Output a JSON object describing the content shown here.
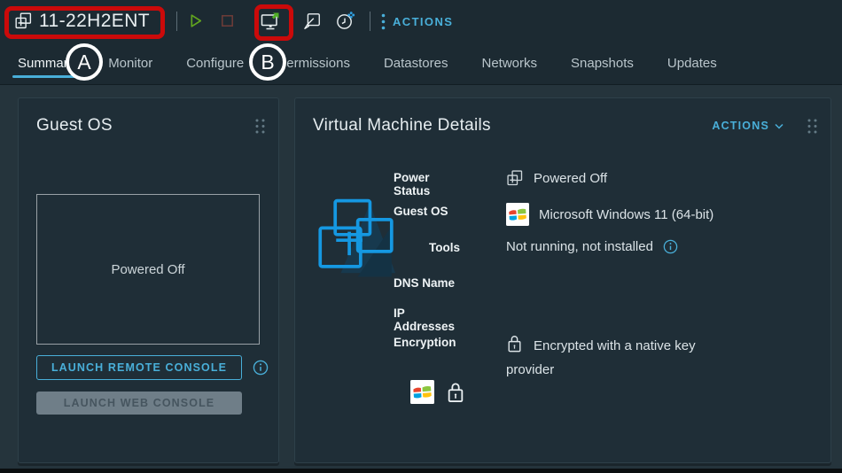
{
  "header": {
    "vm_name": "11-22H2ENT",
    "actions_label": "ACTIONS"
  },
  "tabs": {
    "active": "Summary",
    "items": [
      "Summary",
      "Monitor",
      "Configure",
      "Permissions",
      "Datastores",
      "Networks",
      "Snapshots",
      "Updates"
    ]
  },
  "annotations": {
    "label_a": "A",
    "label_b": "B"
  },
  "guest_os_card": {
    "title": "Guest OS",
    "preview_status": "Powered Off",
    "remote_console_label": "LAUNCH REMOTE CONSOLE",
    "web_console_label": "LAUNCH WEB CONSOLE"
  },
  "details_card": {
    "title": "Virtual Machine Details",
    "actions_label": "ACTIONS",
    "power_status": {
      "label": "Power Status",
      "value": "Powered Off"
    },
    "guest_os": {
      "label": "Guest OS",
      "value": "Microsoft Windows 11 (64-bit)"
    },
    "tools": {
      "label": "Tools",
      "value": "Not running, not installed"
    },
    "dns_name": {
      "label": "DNS Name",
      "value": ""
    },
    "ip_addresses": {
      "label": "IP Addresses",
      "value": ""
    },
    "encryption": {
      "label": "Encryption",
      "value_line1": "Encrypted with a native key",
      "value_line2": "provider"
    }
  },
  "icons": {
    "toolbar": [
      "power-on-icon",
      "power-off-icon",
      "launch-remote-console-icon",
      "edit-settings-icon",
      "schedule-task-icon"
    ],
    "badges": [
      "windows-logo-icon",
      "lock-icon"
    ]
  },
  "colors": {
    "accent_blue": "#49afd9",
    "annotation_red": "#cb0a0a",
    "play_green": "#61a41f",
    "stop_red": "#6d3c38",
    "topbar_bg": "#1c2a32",
    "content_bg": "#25343c",
    "card_bg": "#1f2e37",
    "vm_icon_blue": "#1598e2"
  }
}
